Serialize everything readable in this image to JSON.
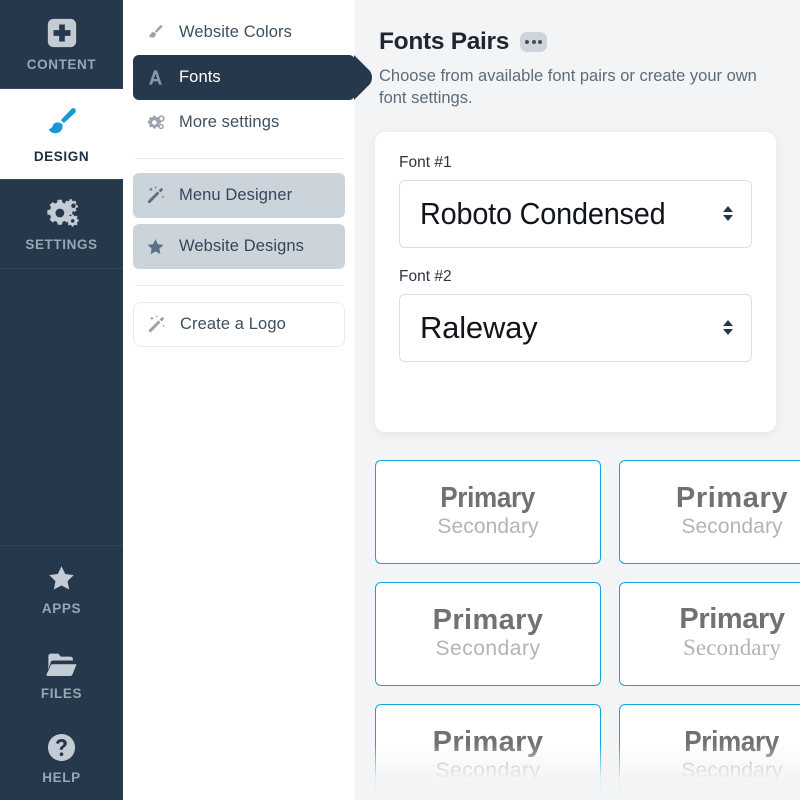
{
  "theme": {
    "rail_bg": "#25384c",
    "rail_label": "#9aa6b2",
    "accent_blue": "#1899d6",
    "card_border_blue": "#19a3de",
    "main_bg": "#f3f4f6",
    "panel_bg": "#ffffff",
    "grey_pill": "#ccd4db"
  },
  "rail": {
    "items": [
      {
        "label": "CONTENT",
        "icon": "plus-square-icon",
        "active": false
      },
      {
        "label": "DESIGN",
        "icon": "paintbrush-icon",
        "active": true
      },
      {
        "label": "SETTINGS",
        "icon": "gears-icon",
        "active": false
      }
    ],
    "bottom_items": [
      {
        "label": "APPS",
        "icon": "star-icon"
      },
      {
        "label": "FILES",
        "icon": "folder-open-icon"
      },
      {
        "label": "HELP",
        "icon": "question-circle-icon"
      }
    ]
  },
  "panel": {
    "group_one": [
      {
        "label": "Website Colors",
        "icon": "paintbrush-small-icon",
        "active": false
      },
      {
        "label": "Fonts",
        "icon": "letter-a-icon",
        "active": true
      },
      {
        "label": "More settings",
        "icon": "gears-small-icon",
        "active": false
      }
    ],
    "group_two": [
      {
        "label": "Menu Designer",
        "icon": "magic-wand-icon"
      },
      {
        "label": "Website Designs",
        "icon": "star-icon"
      }
    ],
    "group_three": [
      {
        "label": "Create a Logo",
        "icon": "magic-wand-icon"
      }
    ]
  },
  "main": {
    "title": "Fonts Pairs",
    "more_badge": "more-options-icon",
    "subtitle": "Choose from available font pairs or create your own font settings.",
    "font_settings": {
      "font1": {
        "label": "Font #1",
        "value": "Roboto Condensed"
      },
      "font2": {
        "label": "Font #2",
        "value": "Raleway"
      }
    },
    "pairs": [
      {
        "primary": "Primary",
        "secondary": "Secondary",
        "style": "f-cond"
      },
      {
        "primary": "Primary",
        "secondary": "Secondary",
        "style": "f-wide"
      },
      {
        "primary": "Primary",
        "secondary": "Secondary",
        "style": "f-round"
      },
      {
        "primary": "Primary",
        "secondary": "Secondary",
        "style": "f-serif"
      },
      {
        "primary": "Primary",
        "secondary": "Secondary",
        "style": "f-round"
      },
      {
        "primary": "Primary",
        "secondary": "Secondary",
        "style": "f-cond"
      }
    ]
  }
}
